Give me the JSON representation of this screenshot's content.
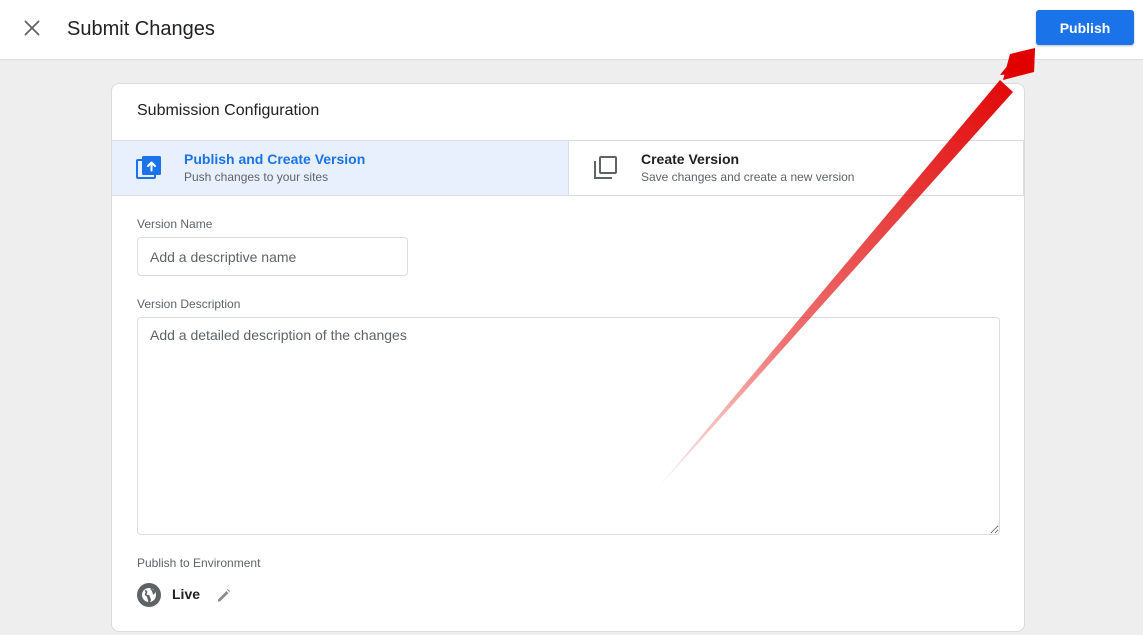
{
  "header": {
    "title": "Submit Changes",
    "publish_label": "Publish",
    "close_icon": "close-icon"
  },
  "card": {
    "title": "Submission Configuration",
    "options": [
      {
        "label": "Publish and Create Version",
        "sub": "Push changes to your sites",
        "icon": "publish-upload-icon",
        "selected": true
      },
      {
        "label": "Create Version",
        "sub": "Save changes and create a new version",
        "icon": "copy-version-icon",
        "selected": false
      }
    ],
    "version_name": {
      "label": "Version Name",
      "value": "",
      "placeholder": "Add a descriptive name"
    },
    "version_description": {
      "label": "Version Description",
      "value": "",
      "placeholder": "Add a detailed description of the changes"
    },
    "environment": {
      "label": "Publish to Environment",
      "name": "Live",
      "icon": "globe-icon",
      "edit_icon": "pencil-icon"
    }
  },
  "colors": {
    "accent": "#1a73e8",
    "selected_bg": "#e8f0fe",
    "page_bg": "#eeeeee",
    "annotation_arrow": "#e00000"
  }
}
